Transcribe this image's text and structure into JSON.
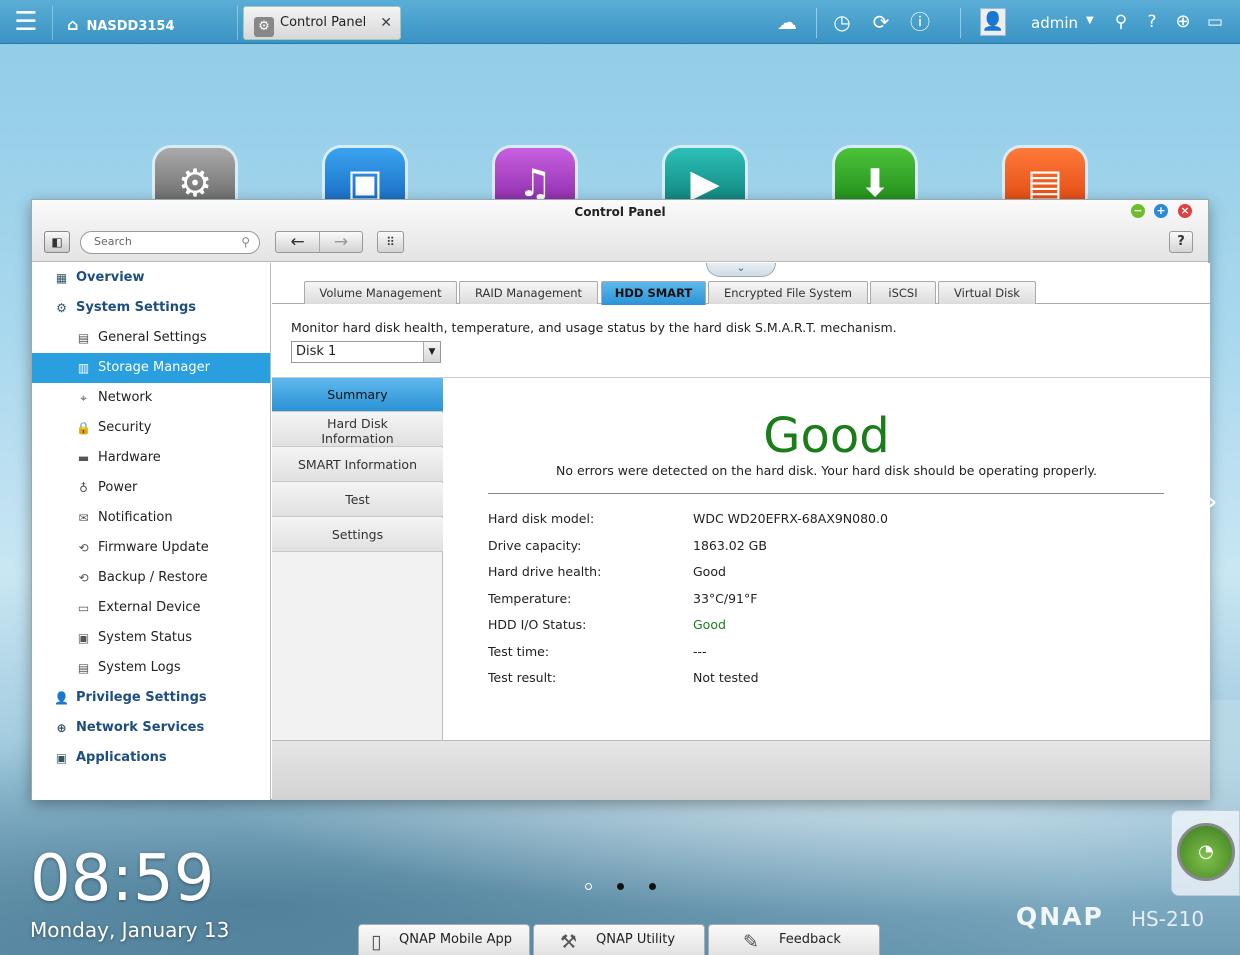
{
  "topbar": {
    "device_name": "NASDD3154",
    "tab_label": "Control Panel",
    "tab_close": "✕",
    "username": "admin",
    "icons": [
      "menu-icon",
      "home-icon",
      "cloud-icon",
      "clock-icon",
      "sync-icon",
      "info-icon",
      "user-icon",
      "search-icon",
      "help-icon",
      "globe-icon",
      "monitor-icon"
    ]
  },
  "window": {
    "title": "Control Panel",
    "search_placeholder": "Search",
    "help_label": "?"
  },
  "sidebar": {
    "items": [
      {
        "label": "Overview",
        "level": "top"
      },
      {
        "label": "System Settings",
        "level": "top"
      },
      {
        "label": "General Settings",
        "level": "sub"
      },
      {
        "label": "Storage Manager",
        "level": "sub",
        "selected": true
      },
      {
        "label": "Network",
        "level": "sub"
      },
      {
        "label": "Security",
        "level": "sub"
      },
      {
        "label": "Hardware",
        "level": "sub"
      },
      {
        "label": "Power",
        "level": "sub"
      },
      {
        "label": "Notification",
        "level": "sub"
      },
      {
        "label": "Firmware Update",
        "level": "sub"
      },
      {
        "label": "Backup / Restore",
        "level": "sub"
      },
      {
        "label": "External Device",
        "level": "sub"
      },
      {
        "label": "System Status",
        "level": "sub"
      },
      {
        "label": "System Logs",
        "level": "sub"
      },
      {
        "label": "Privilege Settings",
        "level": "top"
      },
      {
        "label": "Network Services",
        "level": "top"
      },
      {
        "label": "Applications",
        "level": "top"
      }
    ]
  },
  "tabs": [
    "Volume Management",
    "RAID Management",
    "HDD SMART",
    "Encrypted File System",
    "iSCSI",
    "Virtual Disk"
  ],
  "active_tab": "HDD SMART",
  "smart": {
    "description": "Monitor hard disk health, temperature, and usage status by the hard disk S.M.A.R.T. mechanism.",
    "disk_selected": "Disk 1",
    "menu": [
      "Summary",
      "Hard Disk\nInformation",
      "SMART Information",
      "Test",
      "Settings"
    ],
    "status": "Good",
    "status_message": "No errors were detected on the hard disk. Your hard disk should be operating properly.",
    "details": [
      {
        "label": "Hard disk model:",
        "value": "WDC WD20EFRX-68AX9N080.0"
      },
      {
        "label": "Drive capacity:",
        "value": "1863.02 GB"
      },
      {
        "label": "Hard drive health:",
        "value": "Good"
      },
      {
        "label": "Temperature:",
        "value": "33°C/91°F"
      },
      {
        "label": "HDD I/O Status:",
        "value": "Good"
      },
      {
        "label": "Test time:",
        "value": "---"
      },
      {
        "label": "Test result:",
        "value": "Not tested"
      }
    ],
    "status_color": "#1a7d1a"
  },
  "desktop": {
    "time": "08:59",
    "date": "Monday, January 13",
    "dock": [
      "QNAP Mobile App",
      "QNAP Utility",
      "Feedback"
    ],
    "brand": "QNAP",
    "model": "HS-210"
  },
  "colors": {
    "accent": "#2a9fe0",
    "topbar": "#3a93c4"
  }
}
